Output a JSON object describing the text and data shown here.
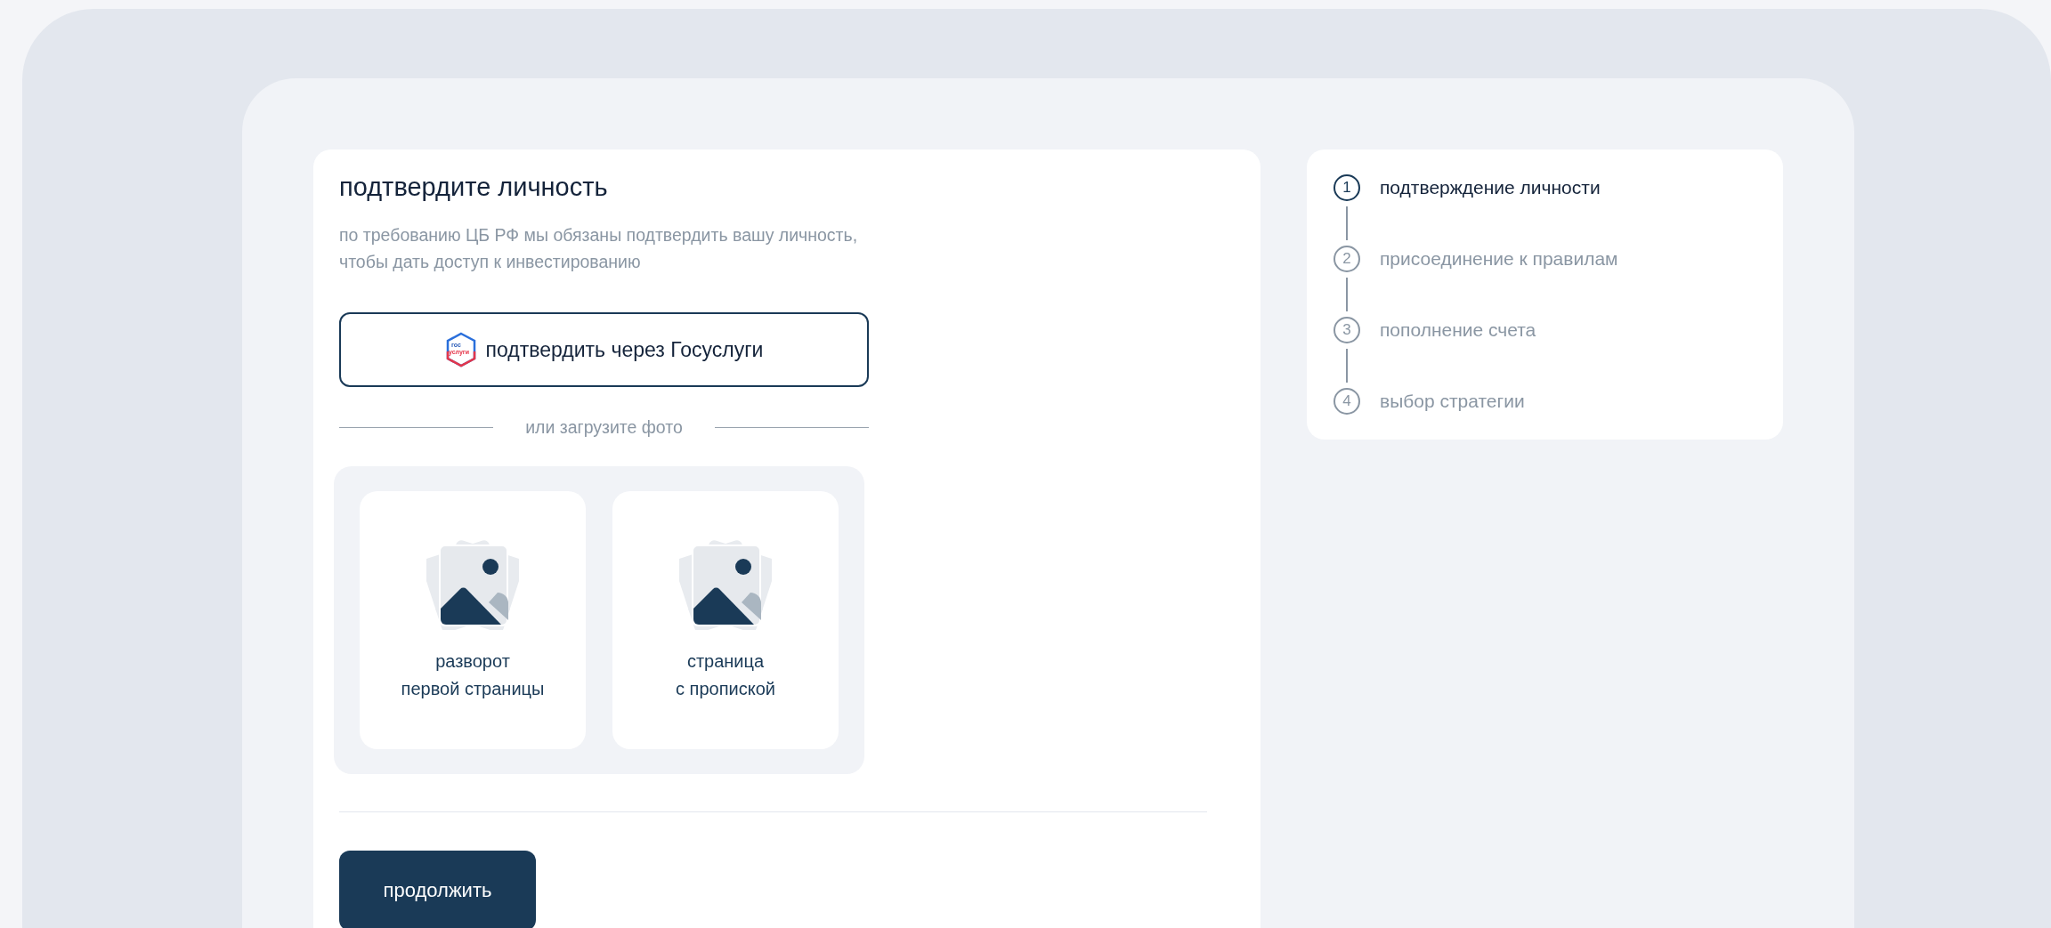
{
  "identity_form": {
    "title": "подтвердите личность",
    "subtitle_lines": [
      "по требованию ЦБ РФ мы обязаны подтвердить вашу личность,",
      "чтобы дать доступ к инвестированию"
    ],
    "gosuslugi_button": {
      "logo_lines": [
        "гос",
        "услуги"
      ],
      "label": "подтвердить через Госуслуги"
    },
    "divider_text": "или загрузите фото",
    "upload_cards": [
      {
        "label_lines": [
          "разворот",
          "первой страницы"
        ]
      },
      {
        "label_lines": [
          "страница",
          "с пропиской"
        ]
      }
    ],
    "continue_button": "продолжить"
  },
  "steps": [
    {
      "number": "1",
      "label": "подтверждение личности",
      "selected": true
    },
    {
      "number": "2",
      "label": "присоединение к правилам",
      "selected": false
    },
    {
      "number": "3",
      "label": "пополнение счета",
      "selected": false
    },
    {
      "number": "4",
      "label": "выбор стратегии",
      "selected": false
    }
  ]
}
